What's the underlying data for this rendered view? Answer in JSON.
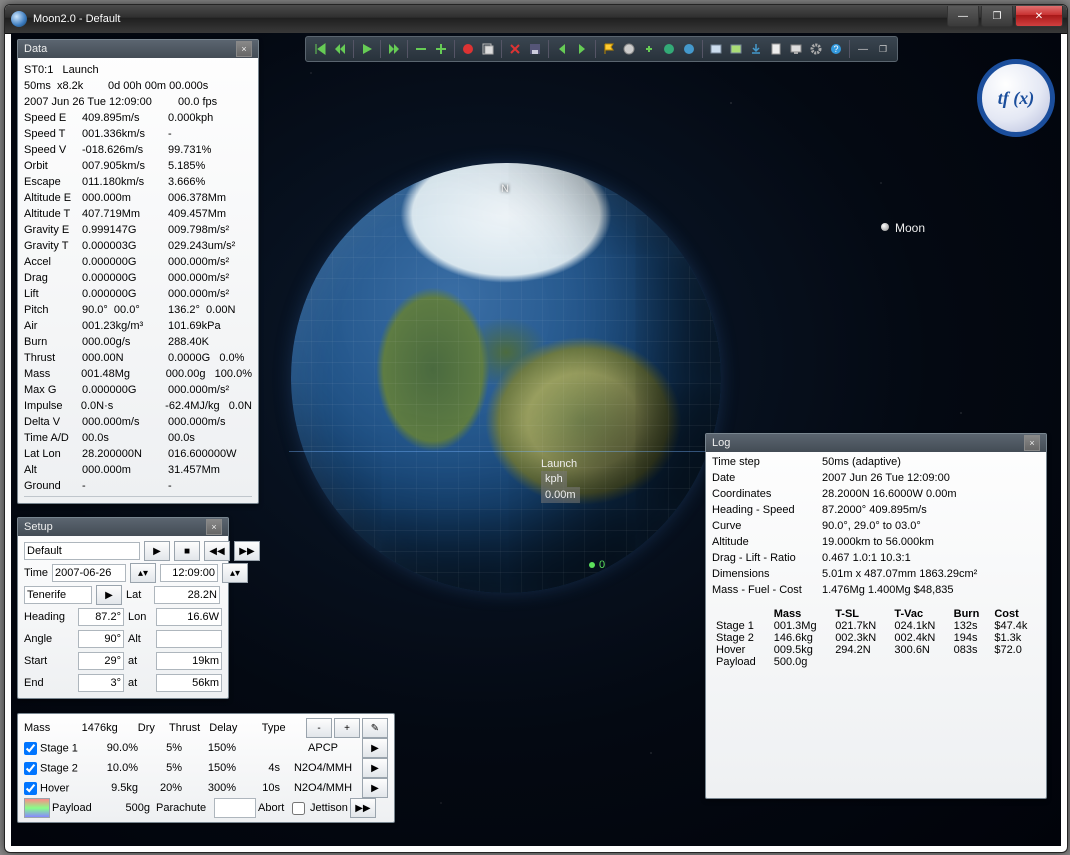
{
  "window": {
    "title": "Moon2.0 - Default"
  },
  "logo": "tf (x)",
  "scene": {
    "moon_label": "Moon",
    "north": "N",
    "zero": "0",
    "launch_tag_line1": "Launch",
    "launch_tag_line2": "kph",
    "launch_tag_line3": "0.00m"
  },
  "data_panel": {
    "title": "Data",
    "header1": "ST0:1   Launch",
    "line2a": "50ms  x8.2k",
    "line2b": "0d 00h 00m 00.000s",
    "line3a": "2007 Jun 26 Tue 12:09:00",
    "line3b": "00.0 fps",
    "rows": [
      {
        "l": "Speed E",
        "v1": "409.895m/s",
        "v2": "0.000kph"
      },
      {
        "l": "Speed T",
        "v1": "001.336km/s",
        "v2": "-"
      },
      {
        "l": "Speed V",
        "v1": "-018.626m/s",
        "v2": "99.731%"
      },
      {
        "l": "Orbit",
        "v1": "007.905km/s",
        "v2": "5.185%"
      },
      {
        "l": "Escape",
        "v1": "011.180km/s",
        "v2": "3.666%"
      },
      {
        "l": "Altitude E",
        "v1": "000.000m",
        "v2": "006.378Mm"
      },
      {
        "l": "Altitude T",
        "v1": "407.719Mm",
        "v2": "409.457Mm"
      },
      {
        "l": "Gravity E",
        "v1": "0.999147G",
        "v2": "009.798m/s²"
      },
      {
        "l": "Gravity T",
        "v1": "0.000003G",
        "v2": "029.243um/s²"
      },
      {
        "l": "Accel",
        "v1": "0.000000G",
        "v2": "000.000m/s²"
      },
      {
        "l": "Drag",
        "v1": "0.000000G",
        "v2": "000.000m/s²"
      },
      {
        "l": "Lift",
        "v1": "0.000000G",
        "v2": "000.000m/s²"
      },
      {
        "l": "Pitch",
        "v1": "90.0°  00.0°",
        "v2": "136.2°  0.00N"
      },
      {
        "l": "Air",
        "v1": "001.23kg/m³",
        "v2": "101.69kPa"
      },
      {
        "l": "Burn",
        "v1": "000.00g/s",
        "v2": "288.40K"
      },
      {
        "l": "Thrust",
        "v1": "000.00N",
        "v2": "0.0000G   0.0%"
      },
      {
        "l": "Mass",
        "v1": "001.48Mg",
        "v2": "000.00g   100.0%"
      },
      {
        "l": "Max G",
        "v1": "0.000000G",
        "v2": "000.000m/s²"
      },
      {
        "l": "Impulse",
        "v1": "0.0N·s",
        "v2": "-62.4MJ/kg   0.0N"
      },
      {
        "l": "Delta V",
        "v1": "000.000m/s",
        "v2": "000.000m/s"
      },
      {
        "l": "Time A/D",
        "v1": "00.0s",
        "v2": "00.0s"
      },
      {
        "l": "Lat Lon",
        "v1": "28.200000N",
        "v2": "016.600000W"
      },
      {
        "l": "Alt",
        "v1": "000.000m",
        "v2": "31.457Mm"
      },
      {
        "l": "Ground",
        "v1": "-",
        "v2": "-"
      }
    ]
  },
  "setup_panel": {
    "title": "Setup",
    "profile": "Default",
    "time_label": "Time",
    "date": "2007-06-26",
    "time": "12:09:00",
    "site": "Tenerife",
    "lat_label": "Lat",
    "lat": "28.2N",
    "heading_label": "Heading",
    "heading": "87.2°",
    "lon_label": "Lon",
    "lon": "16.6W",
    "angle_label": "Angle",
    "angle": "90°",
    "alt_label": "Alt",
    "alt": "",
    "start_label": "Start",
    "start": "29°",
    "at1": "at",
    "start_alt": "19km",
    "end_label": "End",
    "end": "3°",
    "at2": "at",
    "end_alt": "56km"
  },
  "stages_panel": {
    "headers": {
      "mass": "Mass",
      "total": "1476kg",
      "dry": "Dry",
      "thrust": "Thrust",
      "delay": "Delay",
      "type": "Type"
    },
    "rows": [
      {
        "name": "Stage 1",
        "mass": "90.0%",
        "dry": "5%",
        "thrust": "150%",
        "delay": "",
        "type": "APCP"
      },
      {
        "name": "Stage 2",
        "mass": "10.0%",
        "dry": "5%",
        "thrust": "150%",
        "delay": "4s",
        "type": "N2O4/MMH"
      },
      {
        "name": "Hover",
        "mass": "9.5kg",
        "dry": "20%",
        "thrust": "300%",
        "delay": "10s",
        "type": "N2O4/MMH"
      }
    ],
    "payload_label": "Payload",
    "payload": "500g",
    "parachute": "Parachute",
    "abort": "Abort",
    "jettison": "Jettison"
  },
  "log_panel": {
    "title": "Log",
    "rows": [
      {
        "l": "Time step",
        "v": "50ms (adaptive)"
      },
      {
        "l": "Date",
        "v": "2007 Jun 26 Tue 12:09:00"
      },
      {
        "l": "Coordinates",
        "v": "28.2000N  16.6000W  0.00m"
      },
      {
        "l": "Heading - Speed",
        "v": "87.2000°  409.895m/s"
      },
      {
        "l": "Curve",
        "v": "90.0°, 29.0° to 03.0°"
      },
      {
        "l": "Altitude",
        "v": "19.000km to 56.000km"
      },
      {
        "l": "Drag - Lift - Ratio",
        "v": "0.467  1.0:1  10.3:1"
      },
      {
        "l": "Dimensions",
        "v": "5.01m x 487.07mm  1863.29cm²"
      },
      {
        "l": "Mass - Fuel - Cost",
        "v": "1.476Mg  1.400Mg  $48,835"
      }
    ],
    "table": {
      "headers": [
        "",
        "Mass",
        "T-SL",
        "T-Vac",
        "Burn",
        "Cost"
      ],
      "rows": [
        [
          "Stage 1",
          "001.3Mg",
          "021.7kN",
          "024.1kN",
          "132s",
          "$47.4k"
        ],
        [
          "Stage 2",
          "146.6kg",
          "002.3kN",
          "002.4kN",
          "194s",
          "$1.3k"
        ],
        [
          "Hover",
          "009.5kg",
          "294.2N",
          "300.6N",
          "083s",
          "$72.0"
        ],
        [
          "Payload",
          "500.0g",
          "",
          "",
          "",
          ""
        ]
      ]
    }
  }
}
